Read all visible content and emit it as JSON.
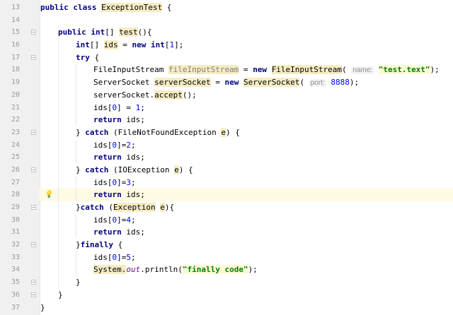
{
  "editor": {
    "current_line": 28,
    "lines": [
      {
        "n": "13",
        "indent": 0,
        "fold": false,
        "tokens": [
          {
            "t": "public class ",
            "c": "kw"
          },
          {
            "t": "ExceptionTest",
            "c": "hl"
          },
          {
            "t": " {",
            "c": ""
          }
        ]
      },
      {
        "n": "14",
        "indent": 0,
        "fold": false,
        "tokens": []
      },
      {
        "n": "15",
        "indent": 1,
        "fold": true,
        "tokens": [
          {
            "t": "public int",
            "c": "kw"
          },
          {
            "t": "[] ",
            "c": ""
          },
          {
            "t": "test",
            "c": "hl"
          },
          {
            "t": "(){",
            "c": ""
          }
        ]
      },
      {
        "n": "16",
        "indent": 2,
        "fold": false,
        "tokens": [
          {
            "t": "int",
            "c": "kw"
          },
          {
            "t": "[] ",
            "c": ""
          },
          {
            "t": "ids",
            "c": "hl"
          },
          {
            "t": " = ",
            "c": ""
          },
          {
            "t": "new int",
            "c": "kw"
          },
          {
            "t": "[",
            "c": ""
          },
          {
            "t": "1",
            "c": "num"
          },
          {
            "t": "];",
            "c": ""
          }
        ]
      },
      {
        "n": "17",
        "indent": 2,
        "fold": true,
        "tokens": [
          {
            "t": "try",
            "c": "kw"
          },
          {
            "t": " {",
            "c": ""
          }
        ]
      },
      {
        "n": "18",
        "indent": 3,
        "fold": false,
        "tokens": [
          {
            "t": "FileInputStream ",
            "c": ""
          },
          {
            "t": "fileInputStream",
            "c": "unused hl"
          },
          {
            "t": " = ",
            "c": ""
          },
          {
            "t": "new ",
            "c": "kw"
          },
          {
            "t": "FileInputStream",
            "c": "hl"
          },
          {
            "t": "( ",
            "c": ""
          },
          {
            "t": "name:",
            "c": "hint"
          },
          {
            "t": " ",
            "c": ""
          },
          {
            "t": "\"test.text\"",
            "c": "str"
          },
          {
            "t": ");",
            "c": ""
          }
        ]
      },
      {
        "n": "19",
        "indent": 3,
        "fold": false,
        "tokens": [
          {
            "t": "ServerSocket ",
            "c": ""
          },
          {
            "t": "serverSocket",
            "c": "hl"
          },
          {
            "t": " = ",
            "c": ""
          },
          {
            "t": "new ",
            "c": "kw"
          },
          {
            "t": "ServerSocket",
            "c": "hl"
          },
          {
            "t": "( ",
            "c": ""
          },
          {
            "t": "port:",
            "c": "hint"
          },
          {
            "t": " ",
            "c": ""
          },
          {
            "t": "8888",
            "c": "num"
          },
          {
            "t": ");",
            "c": ""
          }
        ]
      },
      {
        "n": "20",
        "indent": 3,
        "fold": false,
        "tokens": [
          {
            "t": "serverSocket.",
            "c": ""
          },
          {
            "t": "accept",
            "c": "hl"
          },
          {
            "t": "();",
            "c": ""
          }
        ]
      },
      {
        "n": "21",
        "indent": 3,
        "fold": false,
        "tokens": [
          {
            "t": "ids[",
            "c": ""
          },
          {
            "t": "0",
            "c": "num"
          },
          {
            "t": "] = ",
            "c": ""
          },
          {
            "t": "1",
            "c": "num"
          },
          {
            "t": ";",
            "c": ""
          }
        ]
      },
      {
        "n": "22",
        "indent": 3,
        "fold": false,
        "tokens": [
          {
            "t": "return",
            "c": "kw"
          },
          {
            "t": " ids;",
            "c": ""
          }
        ]
      },
      {
        "n": "23",
        "indent": 2,
        "fold": true,
        "tokens": [
          {
            "t": "} ",
            "c": ""
          },
          {
            "t": "catch",
            "c": "kw"
          },
          {
            "t": " (FileNotFoundException ",
            "c": ""
          },
          {
            "t": "e",
            "c": "hl"
          },
          {
            "t": ") {",
            "c": ""
          }
        ]
      },
      {
        "n": "24",
        "indent": 3,
        "fold": false,
        "tokens": [
          {
            "t": "ids[",
            "c": ""
          },
          {
            "t": "0",
            "c": "num"
          },
          {
            "t": "]=",
            "c": ""
          },
          {
            "t": "2",
            "c": "num"
          },
          {
            "t": ";",
            "c": ""
          }
        ]
      },
      {
        "n": "25",
        "indent": 3,
        "fold": false,
        "tokens": [
          {
            "t": "return",
            "c": "kw"
          },
          {
            "t": " ids;",
            "c": ""
          }
        ]
      },
      {
        "n": "26",
        "indent": 2,
        "fold": true,
        "tokens": [
          {
            "t": "} ",
            "c": ""
          },
          {
            "t": "catch",
            "c": "kw"
          },
          {
            "t": " (IOException ",
            "c": ""
          },
          {
            "t": "e",
            "c": "hl"
          },
          {
            "t": ") {",
            "c": ""
          }
        ]
      },
      {
        "n": "27",
        "indent": 3,
        "fold": false,
        "tokens": [
          {
            "t": "ids[",
            "c": ""
          },
          {
            "t": "0",
            "c": "num"
          },
          {
            "t": "]=",
            "c": ""
          },
          {
            "t": "3",
            "c": "num"
          },
          {
            "t": ";",
            "c": ""
          }
        ]
      },
      {
        "n": "28",
        "indent": 3,
        "fold": false,
        "bulb": true,
        "tokens": [
          {
            "t": "return",
            "c": "kw"
          },
          {
            "t": " ids;",
            "c": ""
          }
        ]
      },
      {
        "n": "29",
        "indent": 2,
        "fold": true,
        "tokens": [
          {
            "t": "}",
            "c": ""
          },
          {
            "t": "catch",
            "c": "kw"
          },
          {
            "t": " (",
            "c": ""
          },
          {
            "t": "Exception",
            "c": "hl"
          },
          {
            "t": " ",
            "c": ""
          },
          {
            "t": "e",
            "c": "hl"
          },
          {
            "t": "){",
            "c": ""
          }
        ]
      },
      {
        "n": "30",
        "indent": 3,
        "fold": false,
        "tokens": [
          {
            "t": "ids[",
            "c": ""
          },
          {
            "t": "0",
            "c": "num"
          },
          {
            "t": "]=",
            "c": ""
          },
          {
            "t": "4",
            "c": "num"
          },
          {
            "t": ";",
            "c": ""
          }
        ]
      },
      {
        "n": "31",
        "indent": 3,
        "fold": false,
        "tokens": [
          {
            "t": "return",
            "c": "kw"
          },
          {
            "t": " ids;",
            "c": ""
          }
        ]
      },
      {
        "n": "32",
        "indent": 2,
        "fold": true,
        "tokens": [
          {
            "t": "}",
            "c": ""
          },
          {
            "t": "finally",
            "c": "kw"
          },
          {
            "t": " {",
            "c": ""
          }
        ]
      },
      {
        "n": "33",
        "indent": 3,
        "fold": false,
        "tokens": [
          {
            "t": "ids[",
            "c": ""
          },
          {
            "t": "0",
            "c": "num"
          },
          {
            "t": "]=",
            "c": ""
          },
          {
            "t": "5",
            "c": "num"
          },
          {
            "t": ";",
            "c": ""
          }
        ]
      },
      {
        "n": "34",
        "indent": 3,
        "fold": false,
        "tokens": [
          {
            "t": "System.",
            "c": "hl"
          },
          {
            "t": "out",
            "c": "field"
          },
          {
            "t": ".println(",
            "c": ""
          },
          {
            "t": "\"finally code\"",
            "c": "str"
          },
          {
            "t": ");",
            "c": ""
          }
        ]
      },
      {
        "n": "35",
        "indent": 2,
        "fold": true,
        "tokens": [
          {
            "t": "}",
            "c": ""
          }
        ]
      },
      {
        "n": "36",
        "indent": 1,
        "fold": true,
        "tokens": [
          {
            "t": "}",
            "c": ""
          }
        ]
      },
      {
        "n": "37",
        "indent": 0,
        "fold": false,
        "tokens": [
          {
            "t": "}",
            "c": ""
          }
        ]
      }
    ]
  }
}
